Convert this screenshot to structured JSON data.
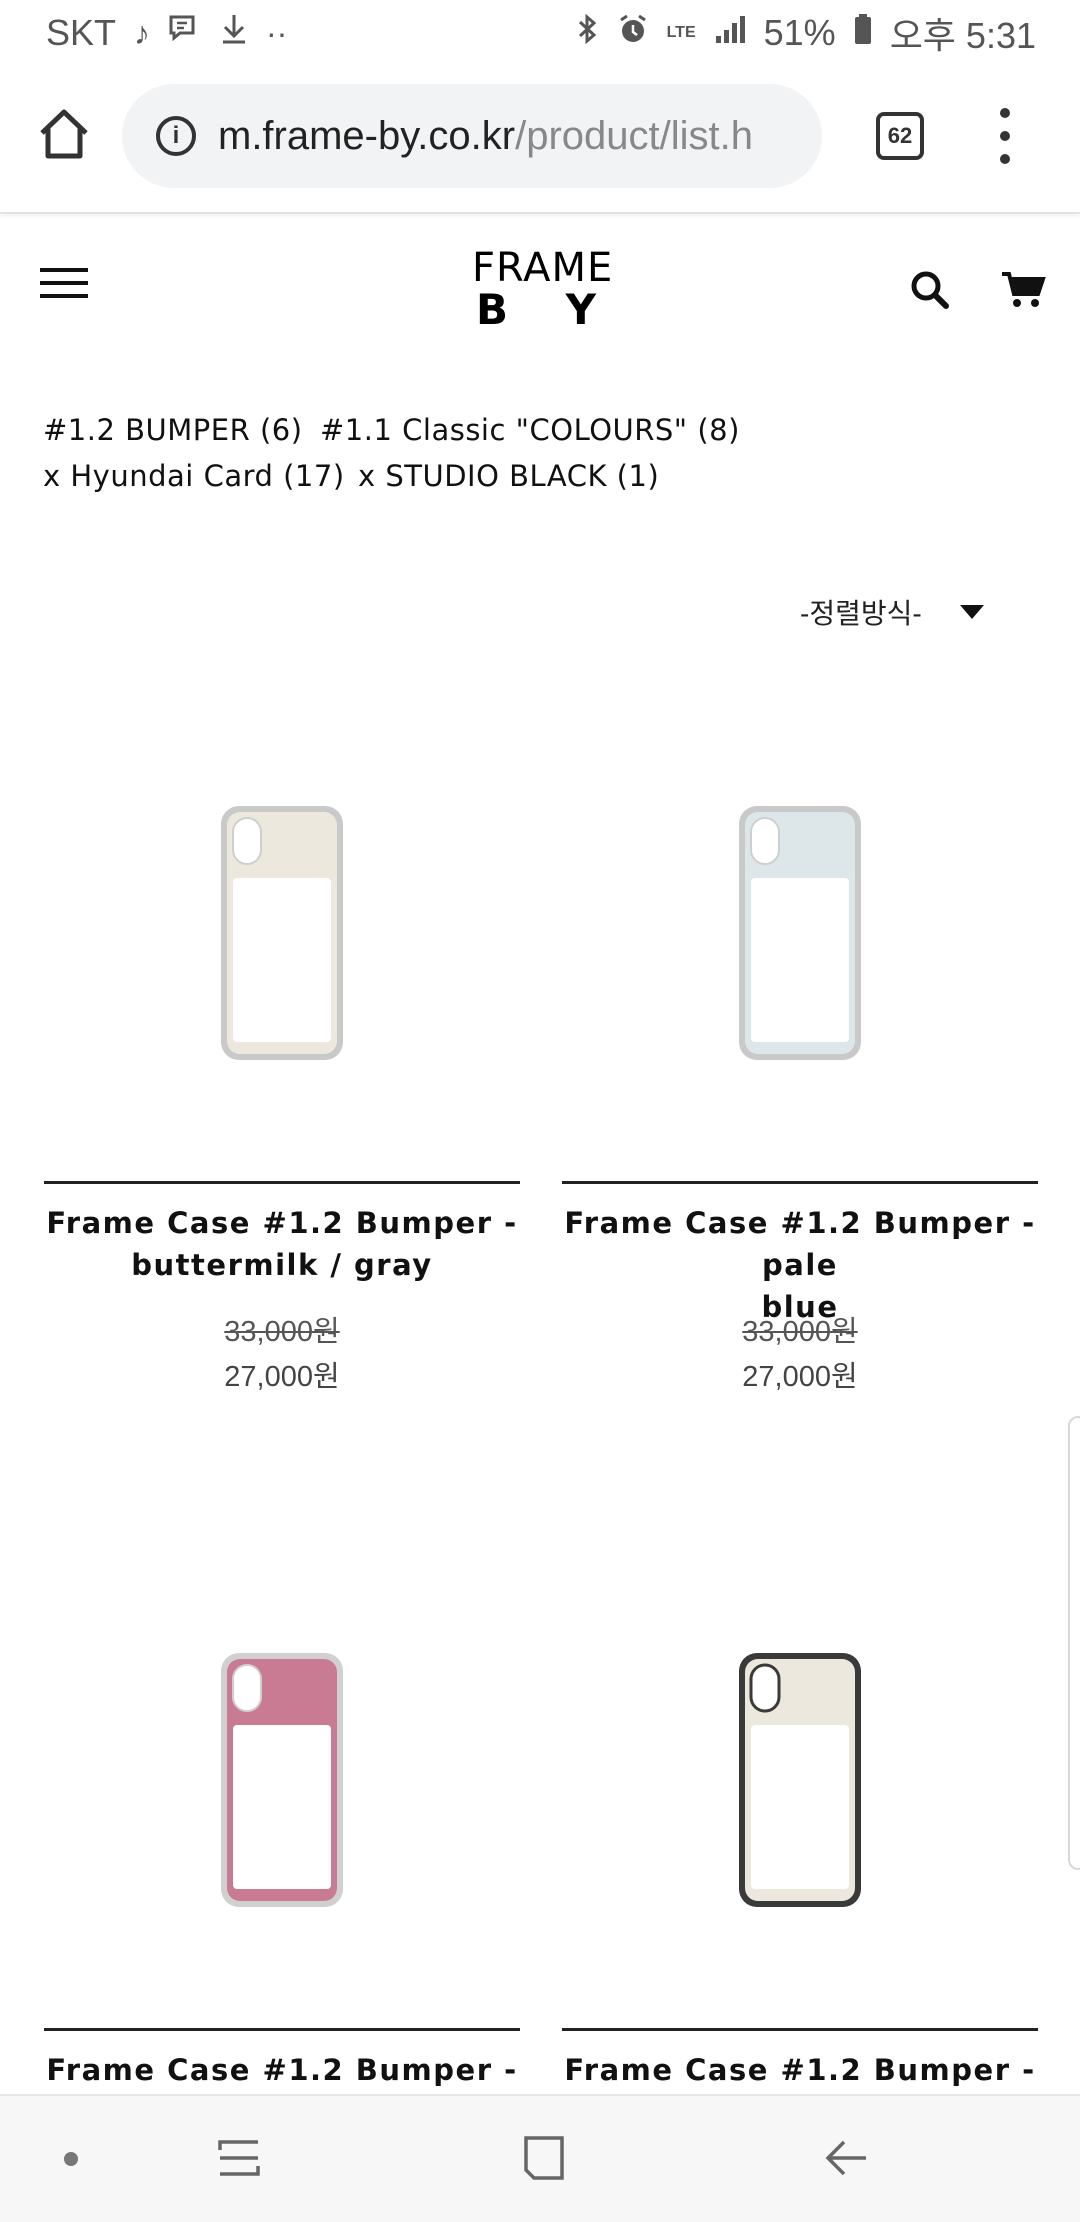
{
  "status_bar": {
    "carrier": "SKT",
    "network": "LTE",
    "battery": "51%",
    "time": "오후 5:31"
  },
  "browser": {
    "url_host": "m.frame-by.co.kr",
    "url_path": "/product/list.h",
    "tab_count": "62"
  },
  "site": {
    "logo_top": "FRAME",
    "logo_b": "B",
    "logo_y": "Y"
  },
  "categories": [
    "#1.2 BUMPER (6)",
    "#1.1 Classic \"COLOURS\" (8)",
    "x Hyundai Card (17)",
    "x STUDIO BLACK (1)"
  ],
  "sort_label": "-정렬방식-",
  "products": [
    {
      "name_line1": "Frame Case #1.2 Bumper -",
      "name_line2": "buttermilk / gray",
      "price_old": "33,000원",
      "price_new": "27,000원",
      "case_color": "#ece8de",
      "bumper_color": "#c9c9c9"
    },
    {
      "name_line1": "Frame Case #1.2 Bumper - pale",
      "name_line2": "blue",
      "price_old": "33,000원",
      "price_new": "27,000원",
      "case_color": "#dde7ea",
      "bumper_color": "#c9c9c9"
    },
    {
      "name_line1": "Frame Case #1.2 Bumper -",
      "name_line2": "",
      "price_old": "",
      "price_new": "",
      "case_color": "#c97b93",
      "bumper_color": "#d0d0d0"
    },
    {
      "name_line1": "Frame Case #1.2 Bumper -",
      "name_line2": "",
      "price_old": "",
      "price_new": "",
      "case_color": "#ece8de",
      "bumper_color": "#3a3a3a"
    }
  ]
}
